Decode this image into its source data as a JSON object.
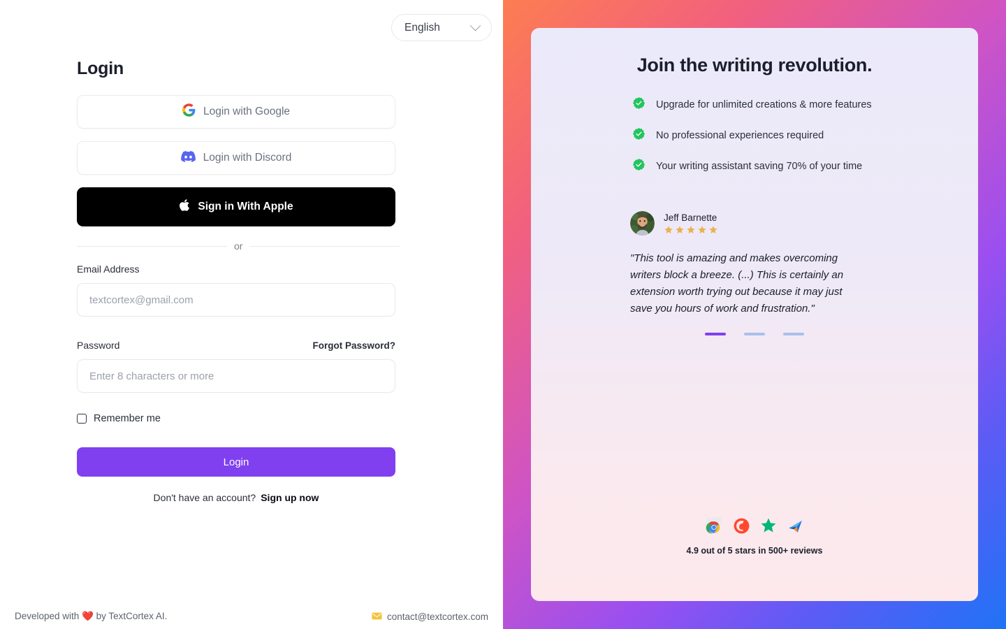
{
  "language_selector": {
    "value": "English",
    "chevron_icon": "chevron-down-icon"
  },
  "login_form": {
    "title": "Login",
    "oauth": [
      {
        "label": "Login with Google",
        "icon": "google-icon"
      },
      {
        "label": "Login with Discord",
        "icon": "discord-icon"
      },
      {
        "label": "Sign in With Apple",
        "icon": "apple-icon"
      }
    ],
    "divider_text": "or",
    "email": {
      "label": "Email Address",
      "placeholder": "textcortex@gmail.com",
      "value": ""
    },
    "password": {
      "label": "Password",
      "forgot_label": "Forgot Password?",
      "placeholder": "Enter 8 characters or more",
      "value": ""
    },
    "remember_me": {
      "label": "Remember me",
      "checked": false
    },
    "submit_label": "Login",
    "signup_prompt": "Don't have an account?",
    "signup_link": "Sign up now"
  },
  "footer": {
    "developed_by": "Developed with ❤️ by TextCortex AI.",
    "contact_email": "contact@textcortex.com",
    "mail_icon": "envelope-icon"
  },
  "promo": {
    "title": "Join the writing revolution.",
    "bullets": [
      "Upgrade for unlimited creations & more features",
      "No professional experiences required",
      "Your writing assistant saving 70% of your time"
    ],
    "bullet_icon": "green-check-badge-icon",
    "testimonial": {
      "author": "Jeff Barnette",
      "avatar_icon": "user-avatar",
      "stars": 5,
      "quote": "\"This tool is amazing and makes overcoming writers block a breeze. (...) This is certainly an extension worth trying out because it may just save you hours of work and frustration.\""
    },
    "carousel": {
      "count": 3,
      "active_index": 0
    },
    "reviews": {
      "text": "4.9 out of 5 stars in 500+ reviews",
      "badges": [
        "chrome-web-store-icon",
        "g2-icon",
        "trustpilot-star-icon",
        "capterra-icon"
      ]
    }
  },
  "colors": {
    "accent_purple": "#8040f0",
    "check_green": "#22c55e",
    "star_gold": "#eab24f",
    "apple_black": "#000000"
  }
}
